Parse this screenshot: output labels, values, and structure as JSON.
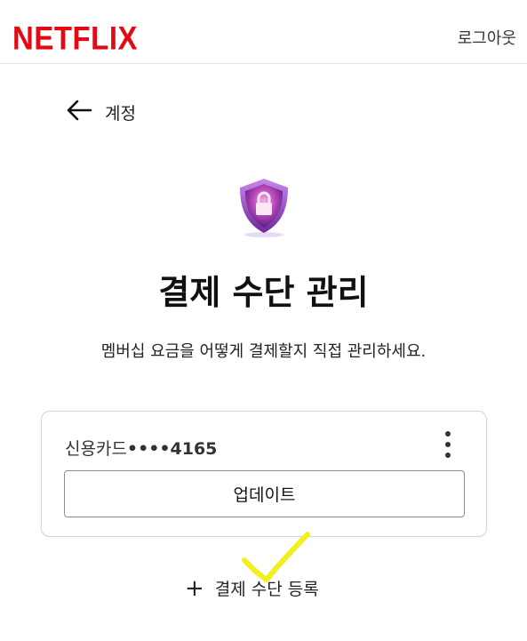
{
  "header": {
    "brand": "NETFLIX",
    "logout_label": "로그아웃"
  },
  "nav": {
    "back_label": "계정",
    "back_icon": "arrow-left-icon"
  },
  "main": {
    "icon": "shield-lock-icon",
    "title": "결제 수단 관리",
    "subtitle": "멤버십 요금을 어떻게 결제할지 직접 관리하세요."
  },
  "payment_method": {
    "type_label": "신용카드",
    "masked_number": "••••4165",
    "menu_icon": "more-vertical-icon",
    "update_label": "업데이트"
  },
  "add_payment": {
    "icon": "plus-icon",
    "label": "결제 수단 등록"
  },
  "colors": {
    "brand_red": "#e50914",
    "annotation_yellow": "#f3ef1d",
    "shield_purple": "#8b2fa8"
  }
}
